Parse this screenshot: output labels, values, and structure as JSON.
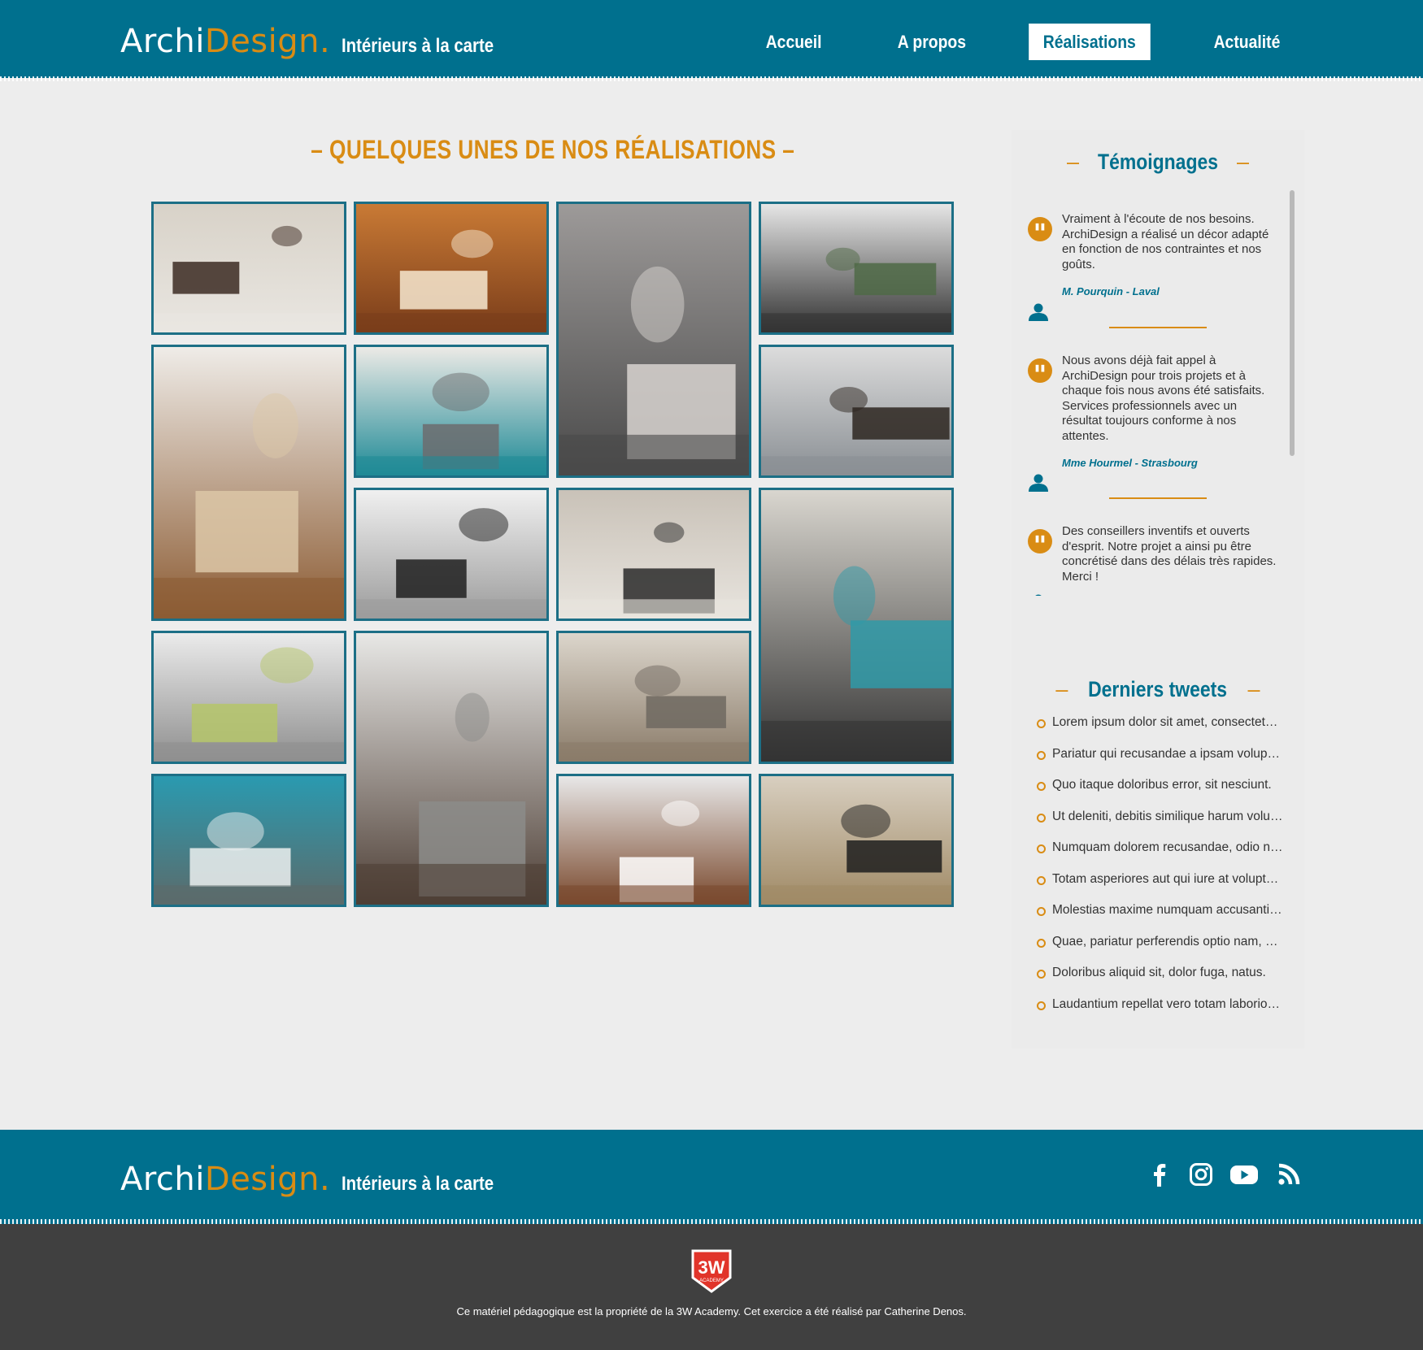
{
  "brand": {
    "archi": "Archi",
    "design": "Design",
    "dot": ".",
    "tagline": "Intérieurs à la carte"
  },
  "nav": [
    {
      "label": "Accueil",
      "active": false
    },
    {
      "label": "A propos",
      "active": false
    },
    {
      "label": "Réalisations",
      "active": true
    },
    {
      "label": "Actualité",
      "active": false
    }
  ],
  "gallery": {
    "title": "– QUELQUES UNES DE NOS RÉALISATIONS –",
    "items": [
      {
        "subject": "bedroom",
        "palette": [
          "#d8d2c8",
          "#3b2a22",
          "#e9e6e1"
        ]
      },
      {
        "subject": "paper lanterns",
        "palette": [
          "#c97a35",
          "#f6e7d0",
          "#7a3d1a"
        ]
      },
      {
        "subject": "vase with flowers",
        "palette": [
          "#9d9a99",
          "#d8d4d0",
          "#4a4a4a"
        ]
      },
      {
        "subject": "cactus plants",
        "palette": [
          "#e6e6e6",
          "#4f6a46",
          "#333333"
        ]
      },
      {
        "subject": "floor lamp",
        "palette": [
          "#efece8",
          "#dcc7a7",
          "#8c5c34"
        ]
      },
      {
        "subject": "living room sofa",
        "palette": [
          "#eceae6",
          "#6c6c6e",
          "#1f8a96"
        ]
      },
      {
        "subject": "kitchen island",
        "palette": [
          "#dcdcdc",
          "#2d2620",
          "#8a8f94"
        ]
      },
      {
        "subject": "kitchen shelves",
        "palette": [
          "#f0f0f0",
          "#1f1f1f",
          "#9c9c9c"
        ]
      },
      {
        "subject": "bedroom with tv",
        "palette": [
          "#c9c2b8",
          "#2a2a2a",
          "#e8e4de"
        ]
      },
      {
        "subject": "white kitchen",
        "palette": [
          "#d9d6cf",
          "#2f9aa8",
          "#333333"
        ]
      },
      {
        "subject": "tulips",
        "palette": [
          "#ebebeb",
          "#b5c56a",
          "#8f8f8f"
        ]
      },
      {
        "subject": "grey armchair",
        "palette": [
          "#e8e8e6",
          "#8c8c8a",
          "#4e3f36"
        ]
      },
      {
        "subject": "chaise armchair",
        "palette": [
          "#dcd6cc",
          "#6f6860",
          "#8a7b69"
        ]
      },
      {
        "subject": "blue office",
        "palette": [
          "#2a9ab0",
          "#ecf0f0",
          "#5b6b6b"
        ]
      },
      {
        "subject": "white lounge chair",
        "palette": [
          "#e8e8e8",
          "#ffffff",
          "#7a4a2e"
        ]
      },
      {
        "subject": "desk with lamp",
        "palette": [
          "#d8cfc0",
          "#1d1d1d",
          "#a08a66"
        ]
      }
    ]
  },
  "testimonials": {
    "title": "Témoignages",
    "items": [
      {
        "text": "Vraiment à l'écoute de nos besoins. ArchiDesign a réalisé un décor adapté en fonction de nos contraintes et nos goûts.",
        "author": "M. Pourquin - Laval"
      },
      {
        "text": "Nous avons déjà fait appel à ArchiDesign pour trois projets et à chaque fois nous avons été satisfaits. Services professionnels avec un résultat toujours conforme à nos attentes.",
        "author": "Mme Hourmel - Strasbourg"
      },
      {
        "text": "Des conseillers inventifs et ouverts d'esprit. Notre projet a ainsi pu être concrétisé dans des délais très rapides. Merci !",
        "author": ""
      }
    ]
  },
  "tweets": {
    "title": "Derniers tweets",
    "items": [
      "Lorem ipsum dolor sit amet, consectetur adipisicing elit.",
      "Pariatur qui recusandae a ipsam voluptatem.",
      "Quo itaque doloribus error, sit nesciunt.",
      "Ut deleniti, debitis similique harum voluptas.",
      "Numquam dolorem recusandae, odio nobis.",
      "Totam asperiores aut qui iure at voluptate.",
      "Molestias maxime numquam accusantium.",
      "Quae, pariatur perferendis optio nam, quis.",
      "Doloribus aliquid sit, dolor fuga, natus.",
      "Laudantium repellat vero totam laboriosam."
    ]
  },
  "footer": {
    "social": [
      "facebook-icon",
      "instagram-icon",
      "youtube-icon",
      "rss-icon"
    ],
    "badge": "3W",
    "badge_sub": "ACADEMY",
    "copyright": "Ce matériel pédagogique est la propriété de la 3W Academy. Cet exercice a été réalisé par Catherine Denos."
  },
  "colors": {
    "primary": "#00708e",
    "accent": "#d98c14",
    "background": "#ededed",
    "bottom": "#404040"
  }
}
